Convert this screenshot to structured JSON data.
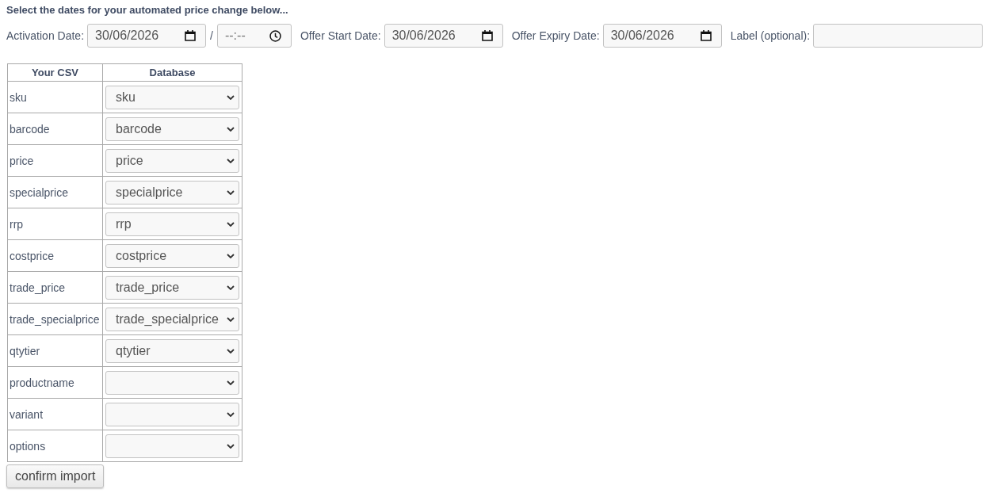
{
  "heading": "Select the dates for your automated price change below...",
  "schedule": [
    {
      "kind": "date",
      "label": "Activation Date:",
      "value": "30/06/2026"
    },
    {
      "kind": "separator",
      "text": "/"
    },
    {
      "kind": "time",
      "placeholder": "--:--"
    },
    {
      "kind": "date",
      "label": "Offer Start Date:",
      "value": "30/06/2026"
    },
    {
      "kind": "date",
      "label": "Offer Expiry Date:",
      "value": "30/06/2026"
    },
    {
      "kind": "text",
      "label": "Label (optional):"
    }
  ],
  "mapping": {
    "columns": [
      "Your CSV",
      "Database"
    ],
    "rows": [
      {
        "csv": "sku",
        "database": "sku"
      },
      {
        "csv": "barcode",
        "database": "barcode"
      },
      {
        "csv": "price",
        "database": "price"
      },
      {
        "csv": "specialprice",
        "database": "specialprice"
      },
      {
        "csv": "rrp",
        "database": "rrp"
      },
      {
        "csv": "costprice",
        "database": "costprice"
      },
      {
        "csv": "trade_price",
        "database": "trade_price"
      },
      {
        "csv": "trade_specialprice",
        "database": "trade_specialprice"
      },
      {
        "csv": "qtytier",
        "database": "qtytier"
      },
      {
        "csv": "productname"
      },
      {
        "csv": "variant"
      },
      {
        "csv": "options"
      }
    ]
  },
  "button": "confirm import"
}
